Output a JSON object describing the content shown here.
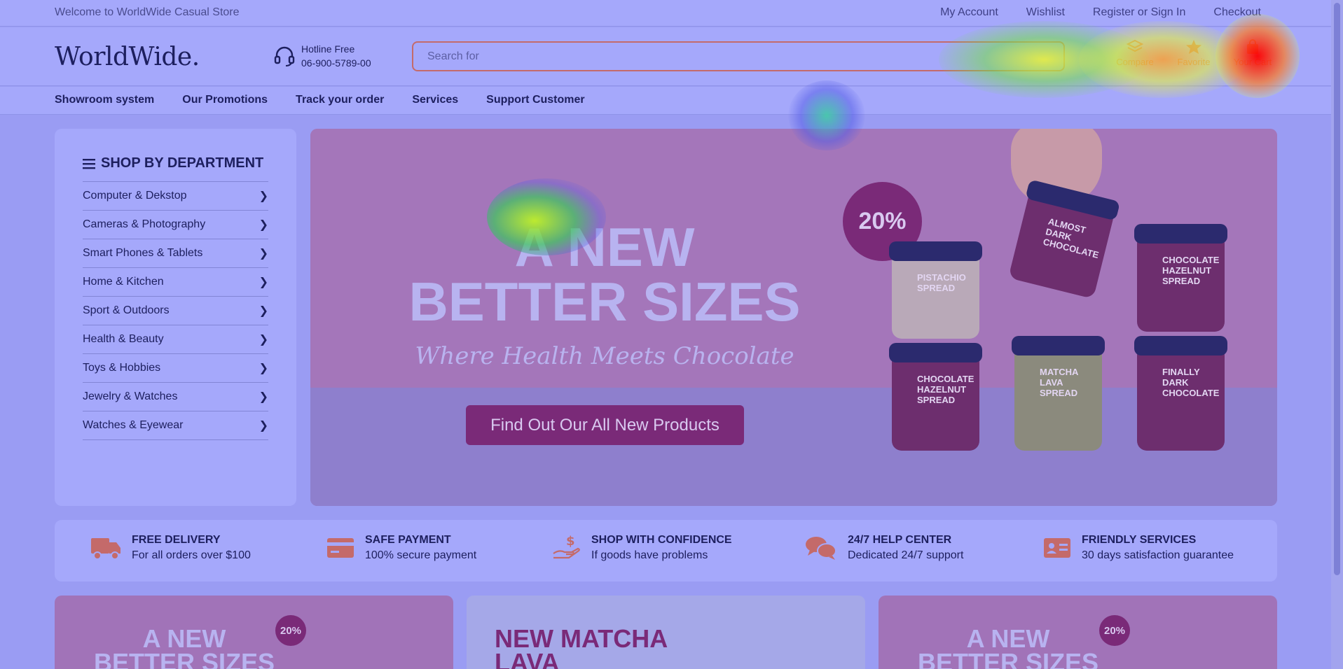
{
  "topbar": {
    "welcome": "Welcome to WorldWide Casual Store",
    "links": [
      "My Account",
      "Wishlist",
      "Register or Sign In",
      "Checkout"
    ]
  },
  "header": {
    "logo": "WorldWide.",
    "hotline_label": "Hotline Free",
    "hotline_number": "06-900-5789-00",
    "search_placeholder": "Search for",
    "icons": [
      {
        "label": "Compare",
        "icon": "layers-icon"
      },
      {
        "label": "Favorite",
        "icon": "star-icon"
      },
      {
        "label": "Your Cart",
        "icon": "bag-icon"
      }
    ]
  },
  "nav": {
    "items": [
      "Showroom system",
      "Our Promotions",
      "Track your order",
      "Services",
      "Support Customer"
    ]
  },
  "departments": {
    "title": "SHOP BY DEPARTMENT",
    "items": [
      "Computer & Dekstop",
      "Cameras & Photography",
      "Smart Phones & Tablets",
      "Home & Kitchen",
      "Sport & Outdoors",
      "Health & Beauty",
      "Toys & Hobbies",
      "Jewelry & Watches",
      "Watches & Eyewear"
    ]
  },
  "hero": {
    "headline_1": "A NEW",
    "headline_2": "BETTER SIZES",
    "subtitle": "Where Health Meets Chocolate",
    "cta": "Find Out Our All New Products",
    "badge": "20%",
    "jars": [
      "PISTACHIO SPREAD",
      "ALMOST DARK CHOCOLATE",
      "CHOCOLATE HAZELNUT SPREAD",
      "CHOCOLATE HAZELNUT SPREAD",
      "MATCHA LAVA SPREAD",
      "FINALLY DARK CHOCOLATE"
    ]
  },
  "features": [
    {
      "title": "FREE DELIVERY",
      "desc": "For all orders over $100",
      "icon": "truck-icon"
    },
    {
      "title": "SAFE PAYMENT",
      "desc": "100% secure payment",
      "icon": "credit-card-icon"
    },
    {
      "title": "SHOP WITH CONFIDENCE",
      "desc": "If goods have problems",
      "icon": "hand-dollar-icon"
    },
    {
      "title": "24/7 HELP CENTER",
      "desc": "Dedicated 24/7 support",
      "icon": "chat-bubbles-icon"
    },
    {
      "title": "FRIENDLY SERVICES",
      "desc": "30 days satisfaction guarantee",
      "icon": "id-card-icon"
    }
  ],
  "promos": [
    {
      "headline_1": "A NEW",
      "headline_2": "BETTER SIZES",
      "badge": "20%"
    },
    {
      "headline_1": "NEW MATCHA",
      "headline_2": "LAVA SPREAD"
    },
    {
      "headline_1": "A NEW",
      "headline_2": "BETTER SIZES",
      "badge": "20%"
    }
  ],
  "colors": {
    "overlay": "#a5a8fb",
    "accent": "#c46a6a",
    "brand_purple": "#7a2a78",
    "text_dark": "#1d1f5e"
  }
}
